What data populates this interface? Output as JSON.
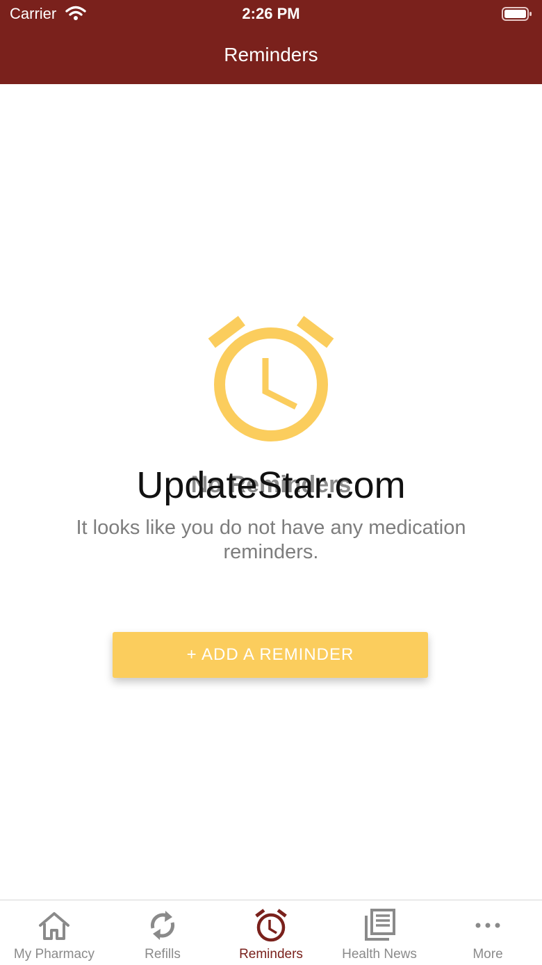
{
  "status": {
    "carrier": "Carrier",
    "time": "2:26 PM"
  },
  "header": {
    "title": "Reminders"
  },
  "empty_state": {
    "icon": "alarm-clock-icon",
    "watermark": "UpdateStar.com",
    "title": "No Reminders",
    "message": "It looks like you do not have any medication reminders.",
    "button_label": "+ ADD A REMINDER"
  },
  "tabs": [
    {
      "label": "My Pharmacy",
      "icon": "home-icon",
      "active": false
    },
    {
      "label": "Refills",
      "icon": "refresh-icon",
      "active": false
    },
    {
      "label": "Reminders",
      "icon": "alarm-clock-icon",
      "active": true
    },
    {
      "label": "Health News",
      "icon": "news-icon",
      "active": false
    },
    {
      "label": "More",
      "icon": "more-dots-icon",
      "active": false
    }
  ],
  "colors": {
    "header": "#7a211c",
    "accent": "#fbcd5d",
    "tab_inactive": "#8a8a8a",
    "tab_active": "#7a211c"
  }
}
